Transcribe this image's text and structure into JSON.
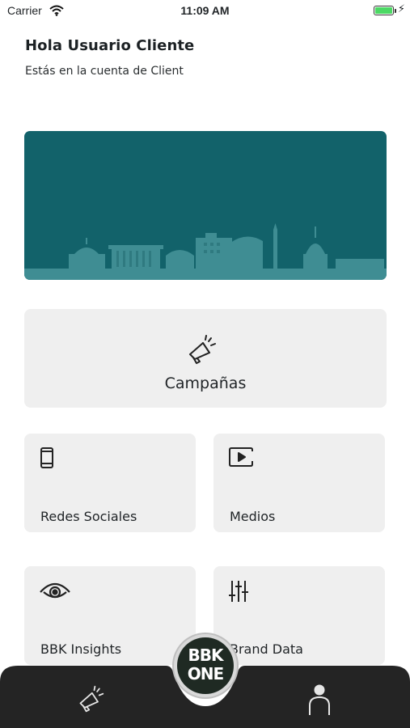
{
  "status_bar": {
    "carrier": "Carrier",
    "time": "11:09 AM",
    "battery_level": 1.0
  },
  "header": {
    "greeting": "Hola Usuario Cliente",
    "account_line": "Estás en la cuenta de Client"
  },
  "tiles": {
    "campaigns": {
      "label": "Campañas",
      "icon": "megaphone-icon"
    },
    "social": {
      "label": "Redes Sociales",
      "icon": "phone-icon"
    },
    "media": {
      "label": "Medios",
      "icon": "play-screen-icon"
    },
    "insights": {
      "label": "BBK Insights",
      "icon": "eye-icon"
    },
    "brand_data": {
      "label": "Brand Data",
      "icon": "sliders-icon"
    }
  },
  "tabbar": {
    "logo_line1": "BBK",
    "logo_line2": "ONE",
    "items": [
      {
        "icon": "megaphone-icon"
      },
      {
        "icon": "profile-icon"
      }
    ]
  },
  "colors": {
    "banner": "#12626a",
    "skyline": "#3f8d93",
    "tile": "#efefef",
    "tabbar": "#242424",
    "accent": "#b6f26a"
  }
}
